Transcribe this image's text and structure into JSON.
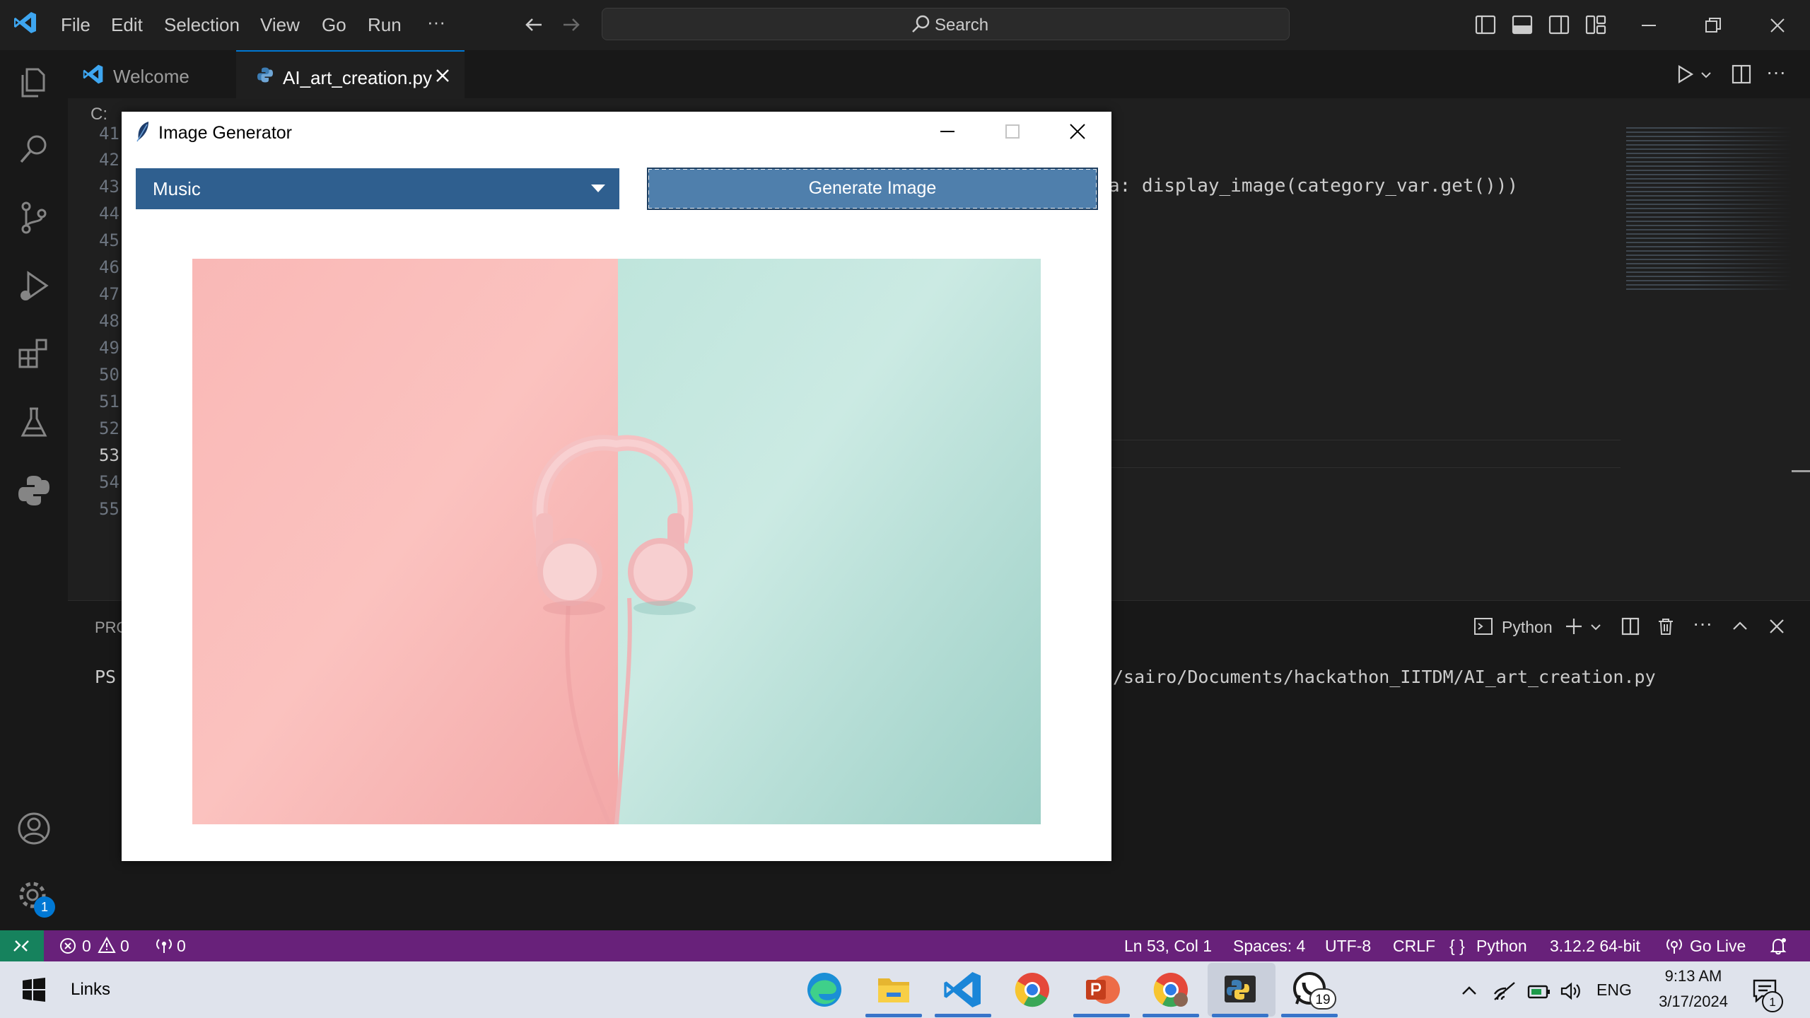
{
  "window": {
    "menu": [
      "File",
      "Edit",
      "Selection",
      "View",
      "Go",
      "Run",
      "···"
    ],
    "search_placeholder": "Search"
  },
  "tabs": [
    {
      "label": "Welcome"
    },
    {
      "label": "AI_art_creation.py"
    }
  ],
  "breadcrumb": "C:",
  "editor": {
    "line_numbers": [
      "41",
      "42",
      "43",
      "44",
      "45",
      "46",
      "47",
      "48",
      "49",
      "50",
      "51",
      "52",
      "53",
      "54",
      "55"
    ],
    "visible_code": "a: display_image(category_var.get()))"
  },
  "panel": {
    "tab_label": "PRO",
    "terminal_profile": "Python",
    "prompt": "PS",
    "path_text": "/sairo/Documents/hackathon_IITDM/AI_art_creation.py"
  },
  "status": {
    "errors": "0",
    "warnings": "0",
    "ports": "0",
    "position": "Ln 53, Col 1",
    "spaces": "Spaces: 4",
    "encoding": "UTF-8",
    "eol": "CRLF",
    "language": "Python",
    "interpreter": "3.12.2 64-bit",
    "go_live": "Go Live",
    "accounts_badge": "1"
  },
  "dialog": {
    "title": "Image Generator",
    "category_selected": "Music",
    "generate_button": "Generate Image"
  },
  "taskbar": {
    "links_label": "Links",
    "language": "ENG",
    "time": "9:13 AM",
    "date": "3/17/2024",
    "whatsapp_badge": "19",
    "notification_badge": "1"
  },
  "colors": {
    "status_bar": "#68217a",
    "remote_indicator": "#16825d",
    "accent": "#0078d4",
    "dropdown_bg": "#2f5f8f",
    "button_bg": "#4f7fac"
  }
}
